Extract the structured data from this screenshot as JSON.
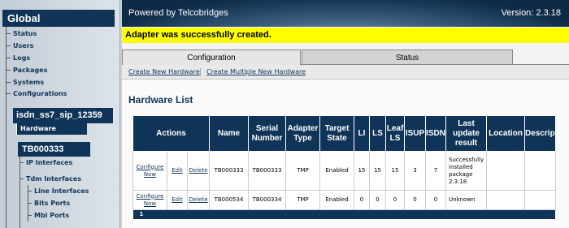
{
  "sidebar": {
    "title": "Global",
    "links": [
      "Status",
      "Users",
      "Logs",
      "Packages",
      "Systems",
      "Configurations"
    ],
    "group_title": "isdn_ss7_sip_12359",
    "active_item": "Hardware",
    "device_title": "TB000333",
    "sub_items": [
      "IP Interfaces",
      "Tdm Interfaces"
    ],
    "tdm_items": [
      "Line Interfaces",
      "Bits Ports",
      "Mbi Ports"
    ]
  },
  "header": {
    "brand": "Powered by Telcobridges",
    "version": "Version: 2.3.18"
  },
  "notice": "Adapter was successfully created.",
  "tabs": [
    "Configuration",
    "Status"
  ],
  "subnav": [
    "Create New Hardware",
    "Create Multiple New Hardware"
  ],
  "hardware_list": {
    "title": "Hardware List",
    "columns": [
      "Actions",
      "Name",
      "Serial Number",
      "Adapter Type",
      "Target State",
      "LI",
      "LS",
      "Leaf LS",
      "ISUP",
      "ISDN",
      "Last update result",
      "Location",
      "Descrip"
    ],
    "action_labels": [
      "Configure Now",
      "Edit",
      "Delete"
    ],
    "rows": [
      {
        "name": "TB000333",
        "serial": "TB000333",
        "type": "TMP",
        "state": "Enabled",
        "li": "15",
        "ls": "15",
        "leaf_ls": "15",
        "isup": "3",
        "isdn": "7",
        "result": "Successfully installed package 2.3.18",
        "location": "",
        "description": ""
      },
      {
        "name": "TB000534",
        "serial": "TB000334",
        "type": "TMP",
        "state": "Enabled",
        "li": "0",
        "ls": "0",
        "leaf_ls": "0",
        "isup": "0",
        "isdn": "0",
        "result": "Unknown",
        "location": "",
        "description": ""
      }
    ],
    "footer_page": "1"
  }
}
